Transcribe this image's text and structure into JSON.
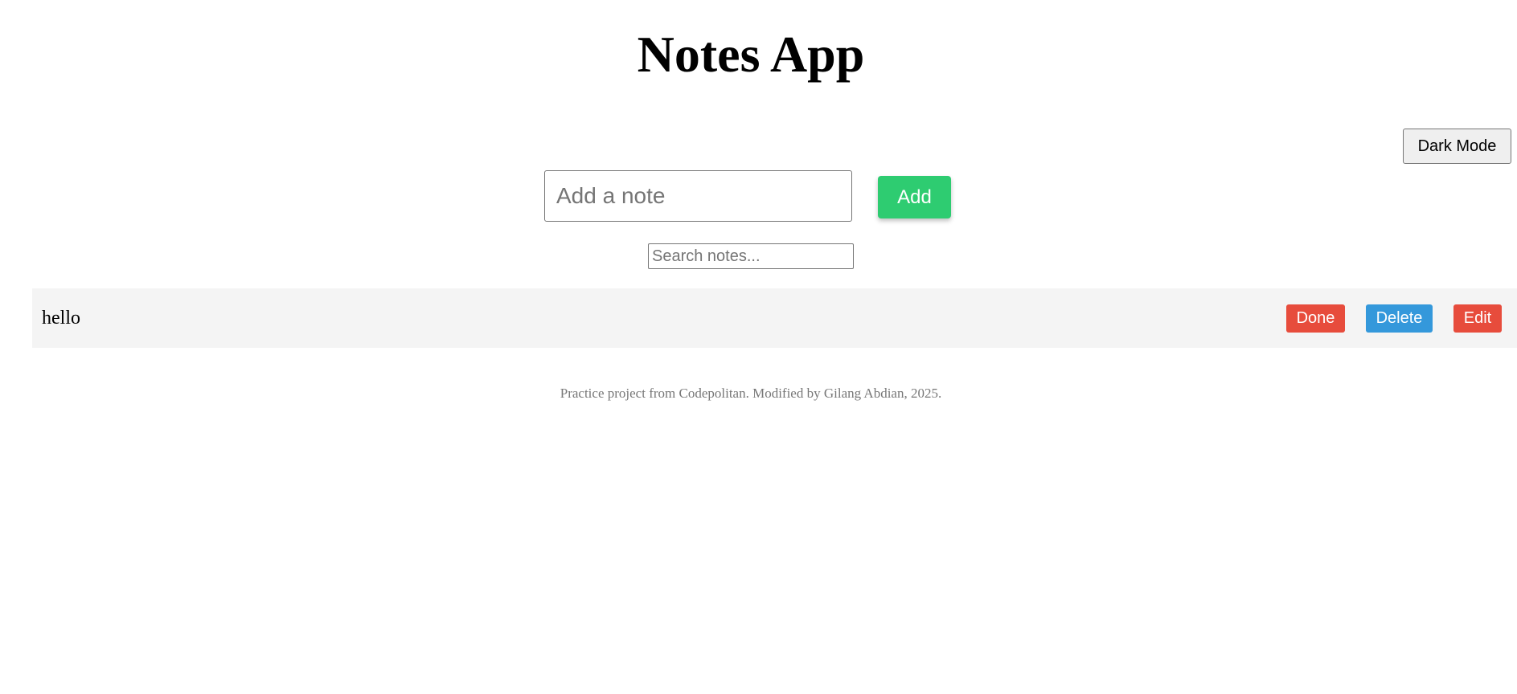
{
  "header": {
    "title": "Notes App"
  },
  "toolbar": {
    "dark_mode_label": "Dark Mode"
  },
  "note_form": {
    "input_value": "",
    "input_placeholder": "Add a note",
    "add_label": "Add"
  },
  "search": {
    "value": "",
    "placeholder": "Search notes..."
  },
  "notes": [
    {
      "text": "hello",
      "done_label": "Done",
      "delete_label": "Delete",
      "edit_label": "Edit"
    }
  ],
  "footer": {
    "text": "Practice project from Codepolitan. Modified by Gilang Abdian, 2025."
  },
  "colors": {
    "add_button": "#2ecc71",
    "done_button": "#e74c3c",
    "delete_button": "#3498db",
    "edit_button": "#e74c3c",
    "note_background": "#f4f4f4"
  }
}
